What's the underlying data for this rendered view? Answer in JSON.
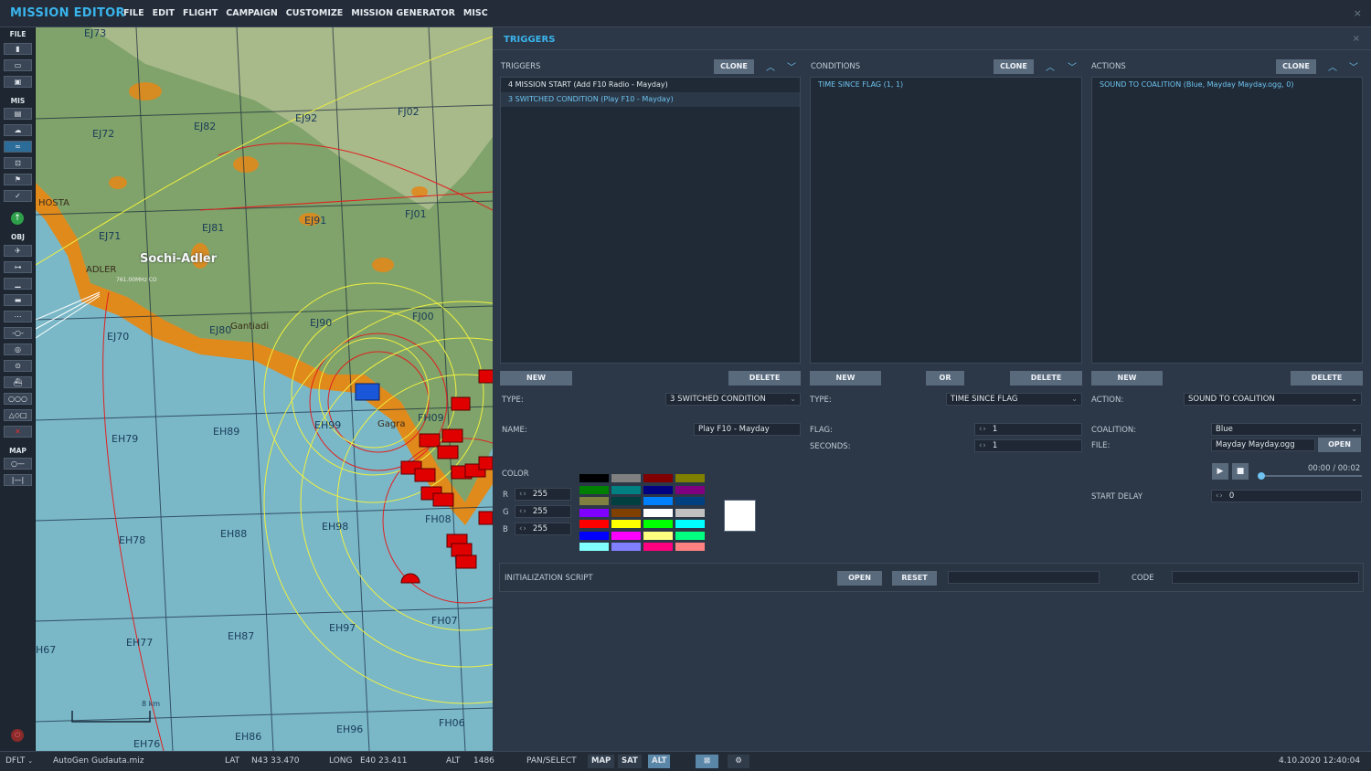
{
  "app": {
    "title": "MISSION EDITOR",
    "close": "×"
  },
  "menu": [
    "FILE",
    "EDIT",
    "FLIGHT",
    "CAMPAIGN",
    "CUSTOMIZE",
    "MISSION GENERATOR",
    "MISC"
  ],
  "toolbar": {
    "file_label": "FILE",
    "mis_label": "MIS",
    "obj_label": "OBJ",
    "map_label": "MAP"
  },
  "map": {
    "grid_labels": [
      {
        "text": "EJ73"
      },
      {
        "text": "EJ82"
      },
      {
        "text": "EJ92"
      },
      {
        "text": "FJ02"
      },
      {
        "text": "EJ72"
      },
      {
        "text": "HOSTA"
      },
      {
        "text": "EJ71"
      },
      {
        "text": "EJ81"
      },
      {
        "text": "EJ91"
      },
      {
        "text": "FJ01"
      },
      {
        "text": "ADLER"
      },
      {
        "text": "EJ70"
      },
      {
        "text": "EJ80"
      },
      {
        "text": "Gantiadi"
      },
      {
        "text": "EJ90"
      },
      {
        "text": "FJ00"
      },
      {
        "text": "EH79"
      },
      {
        "text": "EH89"
      },
      {
        "text": "EH99"
      },
      {
        "text": "Gagra"
      },
      {
        "text": "FH09"
      },
      {
        "text": "EH78"
      },
      {
        "text": "EH88"
      },
      {
        "text": "EH98"
      },
      {
        "text": "FH08"
      },
      {
        "text": "EH77"
      },
      {
        "text": "EH87"
      },
      {
        "text": "EH97"
      },
      {
        "text": "FH07"
      },
      {
        "text": "H67"
      },
      {
        "text": "EH76"
      },
      {
        "text": "EH86"
      },
      {
        "text": "EH96"
      },
      {
        "text": "FH06"
      }
    ],
    "airport": "Sochi-Adler",
    "airport_freq": "761.00MHz CO",
    "scale": "8 km"
  },
  "panel": {
    "title": "TRIGGERS",
    "close": "×",
    "triggers": {
      "header": "TRIGGERS",
      "clone": "CLONE",
      "items": [
        "4 MISSION START (Add F10 Radio - Mayday)",
        "3 SWITCHED CONDITION (Play F10 - Mayday)"
      ],
      "new": "NEW",
      "delete": "DELETE",
      "type_label": "TYPE:",
      "type_value": "3 SWITCHED CONDITION",
      "name_label": "NAME:",
      "name_value": "Play F10 - Mayday",
      "color_label": "COLOR",
      "r_label": "R",
      "g_label": "G",
      "b_label": "B",
      "r": "255",
      "g": "255",
      "b": "255",
      "palette": [
        "#000000",
        "#808080",
        "#800000",
        "#808000",
        "#008000",
        "#008080",
        "#000080",
        "#800080",
        "#808040",
        "#004040",
        "#0080ff",
        "#004080",
        "#8000ff",
        "#804000",
        "#ffffff",
        "#c0c0c0",
        "#ff0000",
        "#ffff00",
        "#00ff00",
        "#00ffff",
        "#0000ff",
        "#ff00ff",
        "#ffff80",
        "#00ff80",
        "#80ffff",
        "#8080ff",
        "#ff0080",
        "#ff8080"
      ],
      "swatch_color": "#ffffff"
    },
    "conditions": {
      "header": "CONDITIONS",
      "clone": "CLONE",
      "items": [
        "TIME SINCE FLAG (1, 1)"
      ],
      "new": "NEW",
      "or": "OR",
      "delete": "DELETE",
      "type_label": "TYPE:",
      "type_value": "TIME SINCE FLAG",
      "flag_label": "FLAG:",
      "flag_value": "1",
      "seconds_label": "SECONDS:",
      "seconds_value": "1"
    },
    "actions": {
      "header": "ACTIONS",
      "clone": "CLONE",
      "items": [
        "SOUND TO COALITION (Blue, Mayday Mayday.ogg, 0)"
      ],
      "new": "NEW",
      "delete": "DELETE",
      "action_label": "ACTION:",
      "action_value": "SOUND TO COALITION",
      "coalition_label": "COALITION:",
      "coalition_value": "Blue",
      "file_label": "FILE:",
      "file_value": "Mayday Mayday.ogg",
      "open": "OPEN",
      "time": "00:00 / 00:02",
      "start_delay_label": "START DELAY",
      "start_delay_value": "0"
    },
    "init": {
      "label": "INITIALIZATION SCRIPT",
      "open": "OPEN",
      "reset": "RESET",
      "code_label": "CODE"
    }
  },
  "status": {
    "mode": "DFLT",
    "file": "AutoGen Gudauta.miz",
    "lat_label": "LAT",
    "lat": "N43 33.470",
    "long_label": "LONG",
    "long": "E40 23.411",
    "alt_label": "ALT",
    "alt": "1486",
    "pan": "PAN/SELECT",
    "map": "MAP",
    "sat": "SAT",
    "alt_btn": "ALT",
    "datetime": "4.10.2020 12:40:04"
  }
}
